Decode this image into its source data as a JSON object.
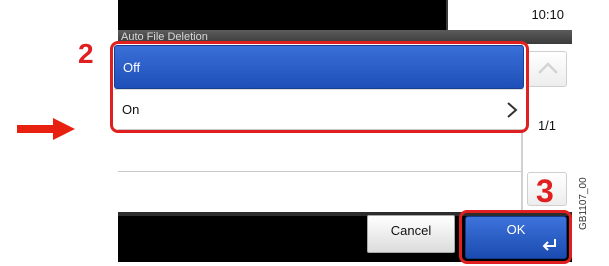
{
  "status_bar": {
    "clock": "10:10"
  },
  "screen": {
    "title": "Auto File Deletion"
  },
  "options": [
    {
      "label": "Off",
      "selected": true
    },
    {
      "label": "On",
      "selected": false
    }
  ],
  "pagination": {
    "indicator": "1/1"
  },
  "buttons": {
    "cancel": "Cancel",
    "ok": "OK"
  },
  "annotations": {
    "step2": "2",
    "step3": "3",
    "figure_code": "GB1107_00"
  },
  "colors": {
    "highlight": "#e02020",
    "selected": "#2a5fc8",
    "accent_arrow": "#e8200f"
  }
}
